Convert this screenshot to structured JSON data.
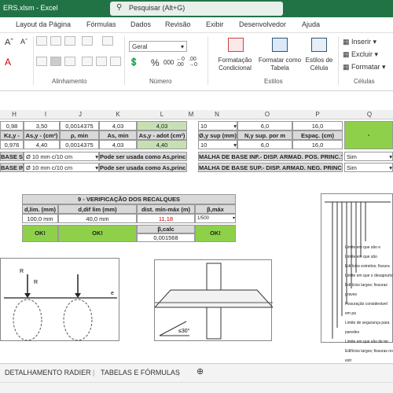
{
  "titlebar": {
    "filename": "ERS.xlsm  -  Excel",
    "search_placeholder": "Pesquisar (Alt+G)"
  },
  "menu": [
    "Layout da Página",
    "Fórmulas",
    "Dados",
    "Revisão",
    "Exibir",
    "Desenvolvedor",
    "Ajuda"
  ],
  "ribbon": {
    "font_color_a": "A",
    "align_label": "Alinhamento",
    "number_label": "Número",
    "number_format": "Geral",
    "percent": "%",
    "thousands": "000",
    "styles_label": "Estilos",
    "cond_format": "Formatação Condicional",
    "format_table": "Formatar como Tabela",
    "cell_styles": "Estilos de Célula",
    "cells_label": "Células",
    "insert": "Inserir",
    "delete": "Excluir",
    "format": "Formatar"
  },
  "columns": [
    "H",
    "I",
    "J",
    "K",
    "L",
    "M",
    "N",
    "O",
    "P",
    "Q"
  ],
  "rows": {
    "r1": [
      "0,98",
      "3,50",
      "0,0014375",
      "4,03",
      "4,03"
    ],
    "r2": [
      "Kz,y -",
      "As,y - (cm²)",
      "ρ, min",
      "As, min",
      "As,y - adot (cm²)"
    ],
    "r3": [
      "0,976",
      "4,40",
      "0,0014375",
      "4,03",
      "4,40"
    ],
    "r4_left": "BASE SUP.",
    "r4_sel": "Ø 10 mm c/10 cm",
    "r4_note": "Pode ser usada como As,princ.",
    "r5_left": "BASE INF.",
    "r5_sel": "Ø 10 mm c/10 cm",
    "r5_note": "Pode ser usada como As,princ.",
    "right_r1": [
      "10",
      "6,0",
      "16,0"
    ],
    "right_r2": [
      "Ø,y sup (mm)",
      "N,y sup. por m",
      "Espaç. (cm)"
    ],
    "right_r3": [
      "10",
      "6,0",
      "16,0"
    ],
    "malha_inf": "MALHA DE BASE INF.- DISP. ARMAD. POS. PRINC.?",
    "malha_sup": "MALHA DE BASE SUP.- DISP. ARMAD. NEG. PRINC.?",
    "sim1": "Sim",
    "sim2": "Sim",
    "q_dash": "-"
  },
  "verif": {
    "title": "9 - VERIFICAÇÃO DOS RECALQUES",
    "headers": [
      "d,lim. (mm)",
      "d,dif lim (mm)",
      "dist. mín-máx (m)",
      "β,máx"
    ],
    "values": [
      "100,0 mm",
      "40,0 mm",
      "11,18",
      "1/500"
    ],
    "ok": [
      "OK!",
      "OK!",
      "OK!"
    ],
    "beta_calc_label": "β,calc",
    "beta_calc": "0,001568"
  },
  "diagram_right_labels": [
    "Limite em que são e",
    "Limite em que são",
    "Edifícios estreitos; fissura",
    "Limite em que o desaprumo",
    "Edifícios largos; fissuras graves",
    "Fissuração considerável em pa",
    "Limite de segurança para paredes",
    "Limite em que são de ter",
    "Edifícios largos; fissuras no estr"
  ],
  "diagram_left_labels": [
    "R",
    "R",
    "e"
  ],
  "angle_label": "≤30°",
  "sheet_tabs": [
    "DETALHAMENTO RADIER",
    "TABELAS E FÓRMULAS"
  ],
  "colors": {
    "excel_green": "#217346",
    "ok_green": "#8ed04a",
    "light_green": "#c6e0b4"
  }
}
